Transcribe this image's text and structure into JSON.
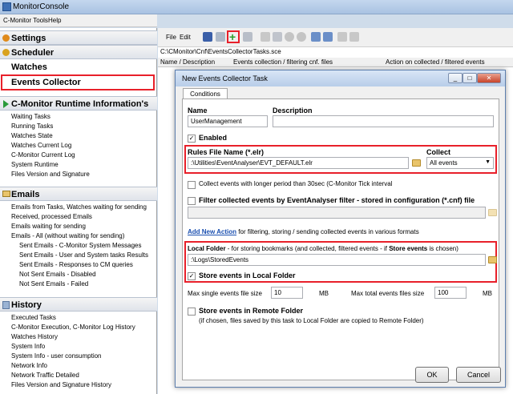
{
  "window": {
    "title": "MonitorConsole"
  },
  "outer_menu": [
    "C-Monitor Tools",
    "Help"
  ],
  "left": {
    "settings": "Settings",
    "scheduler": "Scheduler",
    "watches": "Watches",
    "events_collector": "Events Collector",
    "runtime_header": "C-Monitor Runtime Information's",
    "runtime_items": [
      "Waiting Tasks",
      "Running Tasks",
      "Watches State",
      "Watches Current Log",
      "C-Monitor Current Log",
      "System Runtime",
      "Files Version and Signature"
    ],
    "emails_header": "Emails",
    "email_items": [
      "Emails from Tasks, Watches waiting for sending",
      "Received, processed Emails",
      "Emails waiting for sending",
      "Emails - All (without waiting for sending)"
    ],
    "email_sub_items": [
      "Sent Emails - C-Monitor System Messages",
      "Sent Emails - User and System tasks Results",
      "Sent Emails - Responses to CM queries",
      "Not Sent Emails - Disabled",
      "Not Sent Emails - Failed"
    ],
    "history_header": "History",
    "history_items": [
      "Executed Tasks",
      "C-Monitor Execution, C-Monitor Log History",
      "Watches History",
      "System Info",
      "System Info - user consumption",
      "Network Info",
      "Network Traffic Detailed",
      "Files Version and Signature History"
    ]
  },
  "main": {
    "menu": [
      "File",
      "Edit"
    ],
    "path": "C:\\CMonitor\\Cnf\\EventsCollectorTasks.sce",
    "columns": [
      "Name / Description",
      "Events collection / filtering cnf. files",
      "Action on collected / filtered events"
    ]
  },
  "dialog": {
    "title": "New Events Collector Task",
    "tab": "Conditions",
    "name_label": "Name",
    "name_value": "UserManagement",
    "desc_label": "Description",
    "desc_value": "",
    "enabled_label": "Enabled",
    "rules_label": "Rules File Name (*.elr)",
    "rules_value": ":\\Utilities\\EventAnalyser\\EVT_DEFAULT.elr",
    "collect_label": "Collect",
    "collect_value": "All events",
    "longer_label": "Collect events with longer period than 30sec (C-Monitor Tick interval",
    "filter_label": "Filter collected events by EventAnalyser filter - stored in configuration (*.cnf) file",
    "filter_value": "",
    "add_action_link": "Add New Action",
    "add_action_text": "for filtering, storing / sending collected events in various formats",
    "local_folder_label": "Local Folder",
    "local_folder_desc_1": " - for storing bookmarks (and collected, filtered events - if ",
    "local_folder_desc_bold": "Store events",
    "local_folder_desc_2": " is chosen)",
    "local_folder_value": ":\\Logs\\StoredEvents",
    "store_local_label": "Store events in Local Folder",
    "max_single_label": "Max single events file size",
    "max_single_value": "10",
    "max_single_unit": "MB",
    "max_total_label": "Max total events files size",
    "max_total_value": "100",
    "max_total_unit": "MB",
    "store_remote_label": "Store events in Remote Folder",
    "store_remote_desc": "(if chosen, files saved by this task to Local Folder are copied to Remote Folder)",
    "ok": "OK",
    "cancel": "Cancel"
  },
  "colors": {
    "highlight": "#e8202a",
    "accent": "#3d6fb4"
  }
}
